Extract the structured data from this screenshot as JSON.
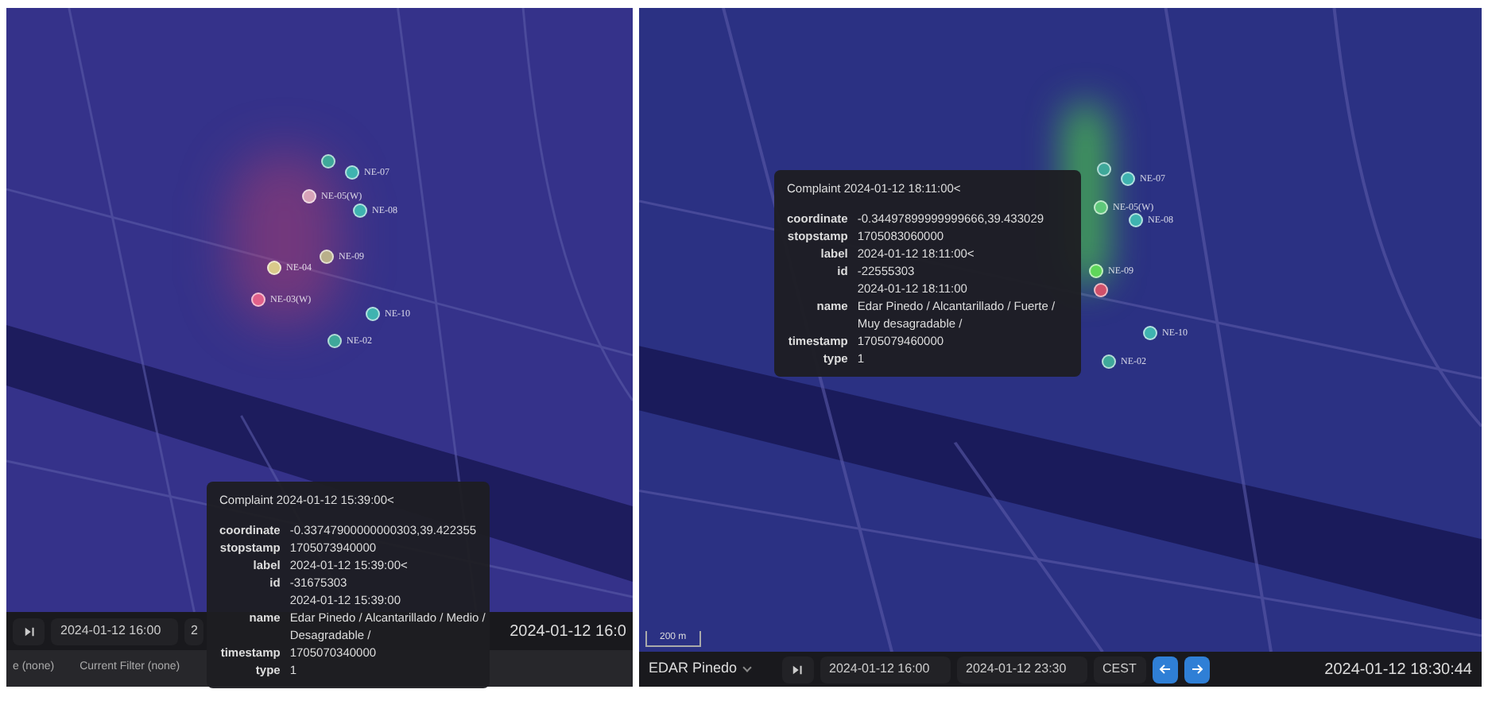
{
  "left_view": {
    "sensors": [
      {
        "color": "#3fa89a"
      },
      {
        "label": "NE-07",
        "color": "#3fb3b0"
      },
      {
        "label": "NE-05(W)",
        "color": "#d7a3b8"
      },
      {
        "label": "NE-08",
        "color": "#3fb3b0"
      },
      {
        "label": "NE-09",
        "color": "#b9b08a"
      },
      {
        "label": "NE-04",
        "color": "#d9c98a"
      },
      {
        "label": "NE-03(W)",
        "color": "#e0608a"
      },
      {
        "label": "NE-10",
        "color": "#3fb3b0"
      },
      {
        "label": "NE-02",
        "color": "#3fa89a"
      }
    ],
    "tooltip": {
      "title": "Complaint 2024-01-12 15:39:00<",
      "fields": [
        {
          "key": "coordinate",
          "lines": [
            "-0.33747900000000303,39.422355"
          ]
        },
        {
          "key": "stopstamp",
          "lines": [
            "1705073940000"
          ]
        },
        {
          "key": "label",
          "lines": [
            "2024-01-12 15:39:00<"
          ]
        },
        {
          "key": "id",
          "lines": [
            "-31675303",
            "2024-01-12 15:39:00"
          ]
        },
        {
          "key": "name",
          "lines": [
            "Edar Pinedo / Alcantarillado / Medio /",
            "Desagradable /"
          ]
        },
        {
          "key": "timestamp",
          "lines": [
            "1705070340000"
          ]
        },
        {
          "key": "type",
          "lines": [
            "1"
          ]
        }
      ]
    },
    "time_bar": {
      "start": "2024-01-12 16:00",
      "end": "2",
      "current": "2024-01-12 16:0"
    },
    "filter_bar": [
      "e (none)",
      "Current Filter (none)"
    ]
  },
  "right_view": {
    "sensors": [
      {
        "color": "#3fa89a"
      },
      {
        "label": "NE-07",
        "color": "#3fb3b0"
      },
      {
        "label": "NE-05(W)",
        "color": "#5fc87a"
      },
      {
        "label": "NE-08",
        "color": "#3fb3b0"
      },
      {
        "label": "NE-09",
        "color": "#5fd65a"
      },
      {
        "color": "#d0506a"
      },
      {
        "label": "NE-10",
        "color": "#3fb3b0"
      },
      {
        "label": "NE-02",
        "color": "#3fa89a"
      }
    ],
    "tooltip": {
      "title": "Complaint 2024-01-12 18:11:00<",
      "fields": [
        {
          "key": "coordinate",
          "lines": [
            "-0.34497899999999666,39.433029"
          ]
        },
        {
          "key": "stopstamp",
          "lines": [
            "1705083060000"
          ]
        },
        {
          "key": "label",
          "lines": [
            "2024-01-12 18:11:00<"
          ]
        },
        {
          "key": "id",
          "lines": [
            "-22555303",
            "2024-01-12 18:11:00"
          ]
        },
        {
          "key": "name",
          "lines": [
            "Edar Pinedo / Alcantarillado / Fuerte /",
            "Muy desagradable /"
          ]
        },
        {
          "key": "timestamp",
          "lines": [
            "1705079460000"
          ]
        },
        {
          "key": "type",
          "lines": [
            "1"
          ]
        }
      ]
    },
    "scale": "200 m",
    "time_bar": {
      "station": "EDAR Pinedo",
      "start": "2024-01-12 16:00",
      "end": "2024-01-12 23:30",
      "timezone": "CEST",
      "current": "2024-01-12 18:30:44"
    }
  }
}
